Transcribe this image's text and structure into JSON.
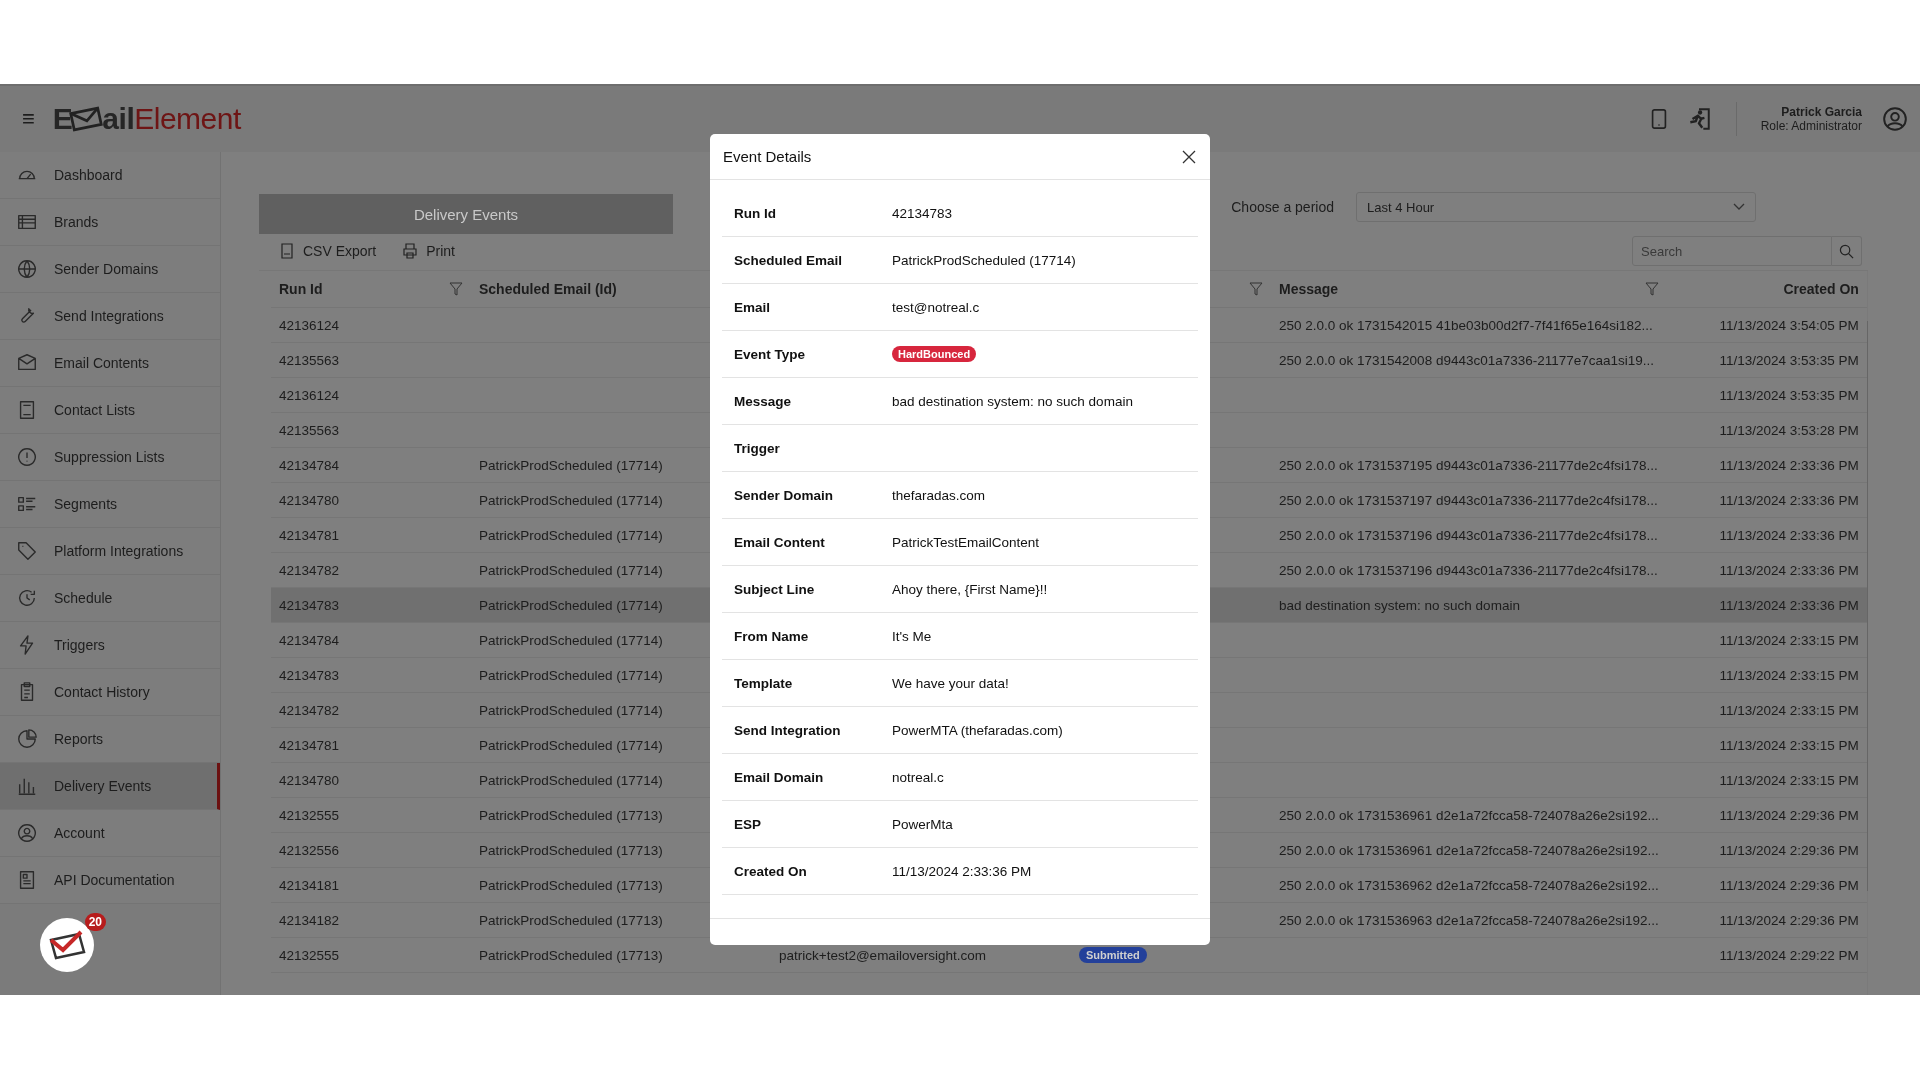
{
  "header": {
    "menu_glyph": "≡",
    "logo": {
      "lead": "E",
      "middle": "ail",
      "accent": "Element"
    },
    "user": {
      "name": "Patrick Garcia",
      "role": "Role: Administrator"
    }
  },
  "sidebar": {
    "items": [
      {
        "label": "Dashboard",
        "selected": false
      },
      {
        "label": "Brands",
        "selected": false
      },
      {
        "label": "Sender Domains",
        "selected": false
      },
      {
        "label": "Send Integrations",
        "selected": false
      },
      {
        "label": "Email Contents",
        "selected": false
      },
      {
        "label": "Contact Lists",
        "selected": false
      },
      {
        "label": "Suppression Lists",
        "selected": false
      },
      {
        "label": "Segments",
        "selected": false
      },
      {
        "label": "Platform Integrations",
        "selected": false
      },
      {
        "label": "Schedule",
        "selected": false
      },
      {
        "label": "Triggers",
        "selected": false
      },
      {
        "label": "Contact History",
        "selected": false
      },
      {
        "label": "Reports",
        "selected": false
      },
      {
        "label": "Delivery Events",
        "selected": true
      },
      {
        "label": "Account",
        "selected": false
      },
      {
        "label": "API Documentation",
        "selected": false
      }
    ]
  },
  "notification": {
    "count": "20"
  },
  "tab": {
    "label": "Delivery Events"
  },
  "toolbar": {
    "buttons": [
      "CSV Export",
      "Print"
    ]
  },
  "period": {
    "label": "Choose a period",
    "value": "Last 4 Hour"
  },
  "search": {
    "placeholder": "Search"
  },
  "table": {
    "columns": [
      {
        "label": "Run Id",
        "filterable": true
      },
      {
        "label": "Scheduled Email (Id)"
      },
      {},
      {
        "filterable": true
      },
      {
        "label": "Message",
        "filterable": true
      },
      {
        "label": "Created On",
        "filterable": false
      }
    ],
    "rows": [
      {
        "run_id": "42136124",
        "message": "250 2.0.0 ok 1731542015 41be03b00d2f7-7f41f65e164si182...",
        "created_on": "11/13/2024 3:54:05 PM",
        "selected": false
      },
      {
        "run_id": "42135563",
        "message": "250 2.0.0 ok 1731542008 d9443c01a7336-21177e7caa1si19...",
        "created_on": "11/13/2024 3:53:35 PM",
        "selected": false
      },
      {
        "run_id": "42136124",
        "created_on": "11/13/2024 3:53:35 PM",
        "selected": false
      },
      {
        "run_id": "42135563",
        "created_on": "11/13/2024 3:53:28 PM",
        "selected": false
      },
      {
        "run_id": "42134784",
        "scheduled_email": "PatrickProdScheduled (17714)",
        "message": "250 2.0.0 ok 1731537195 d9443c01a7336-21177de2c4fsi178...",
        "created_on": "11/13/2024 2:33:36 PM",
        "selected": false
      },
      {
        "run_id": "42134780",
        "scheduled_email": "PatrickProdScheduled (17714)",
        "message": "250 2.0.0 ok 1731537197 d9443c01a7336-21177de2c4fsi178...",
        "created_on": "11/13/2024 2:33:36 PM",
        "selected": false
      },
      {
        "run_id": "42134781",
        "scheduled_email": "PatrickProdScheduled (17714)",
        "message": "250 2.0.0 ok 1731537196 d9443c01a7336-21177de2c4fsi178...",
        "created_on": "11/13/2024 2:33:36 PM",
        "selected": false
      },
      {
        "run_id": "42134782",
        "scheduled_email": "PatrickProdScheduled (17714)",
        "message": "250 2.0.0 ok 1731537196 d9443c01a7336-21177de2c4fsi178...",
        "created_on": "11/13/2024 2:33:36 PM",
        "selected": false
      },
      {
        "run_id": "42134783",
        "scheduled_email": "PatrickProdScheduled (17714)",
        "message": "bad destination system: no such domain",
        "created_on": "11/13/2024 2:33:36 PM",
        "selected": true
      },
      {
        "run_id": "42134784",
        "scheduled_email": "PatrickProdScheduled (17714)",
        "created_on": "11/13/2024 2:33:15 PM",
        "selected": false
      },
      {
        "run_id": "42134783",
        "scheduled_email": "PatrickProdScheduled (17714)",
        "created_on": "11/13/2024 2:33:15 PM",
        "selected": false
      },
      {
        "run_id": "42134782",
        "scheduled_email": "PatrickProdScheduled (17714)",
        "created_on": "11/13/2024 2:33:15 PM",
        "selected": false
      },
      {
        "run_id": "42134781",
        "scheduled_email": "PatrickProdScheduled (17714)",
        "created_on": "11/13/2024 2:33:15 PM",
        "selected": false
      },
      {
        "run_id": "42134780",
        "scheduled_email": "PatrickProdScheduled (17714)",
        "created_on": "11/13/2024 2:33:15 PM",
        "selected": false
      },
      {
        "run_id": "42132555",
        "scheduled_email": "PatrickProdScheduled (17713)",
        "message": "250 2.0.0 ok 1731536961 d2e1a72fcca58-724078a26e2si192...",
        "created_on": "11/13/2024 2:29:36 PM",
        "selected": false
      },
      {
        "run_id": "42132556",
        "scheduled_email": "PatrickProdScheduled (17713)",
        "message": "250 2.0.0 ok 1731536961 d2e1a72fcca58-724078a26e2si192...",
        "created_on": "11/13/2024 2:29:36 PM",
        "selected": false
      },
      {
        "run_id": "42134181",
        "scheduled_email": "PatrickProdScheduled (17713)",
        "message": "250 2.0.0 ok 1731536962 d2e1a72fcca58-724078a26e2si192...",
        "created_on": "11/13/2024 2:29:36 PM",
        "selected": false
      },
      {
        "run_id": "42134182",
        "scheduled_email": "PatrickProdScheduled (17713)",
        "message": "250 2.0.0 ok 1731536963 d2e1a72fcca58-724078a26e2si192...",
        "created_on": "11/13/2024 2:29:36 PM",
        "selected": false
      },
      {
        "run_id": "42132555",
        "scheduled_email": "PatrickProdScheduled (17713)",
        "email": "patrick+test2@emailoversight.com",
        "event_type": {
          "label": "Submitted",
          "color": "#23409a"
        },
        "created_on": "11/13/2024 2:29:22 PM",
        "selected": false
      }
    ]
  },
  "modal": {
    "title": "Event Details",
    "fields": [
      {
        "label": "Run Id",
        "kind": "text",
        "value": "42134783"
      },
      {
        "label": "Scheduled Email",
        "kind": "text",
        "value": "PatrickProdScheduled (17714)"
      },
      {
        "label": "Email",
        "kind": "text",
        "value": "test@notreal.c"
      },
      {
        "label": "Event Type",
        "kind": "badge",
        "value": "HardBounced",
        "color": "#d7263d"
      },
      {
        "label": "Message",
        "kind": "text",
        "value": "bad destination system: no such domain"
      },
      {
        "label": "Trigger",
        "kind": "text"
      },
      {
        "label": "Sender Domain",
        "kind": "text",
        "value": "thefaradas.com"
      },
      {
        "label": "Email Content",
        "kind": "text",
        "value": "PatrickTestEmailContent"
      },
      {
        "label": "Subject Line",
        "kind": "text",
        "value": "Ahoy there, {First Name}!!"
      },
      {
        "label": "From Name",
        "kind": "text",
        "value": "It's Me"
      },
      {
        "label": "Template",
        "kind": "text",
        "value": "We have your data!"
      },
      {
        "label": "Send Integration",
        "kind": "text",
        "value": "PowerMTA (thefaradas.com)"
      },
      {
        "label": "Email Domain",
        "kind": "text",
        "value": "notreal.c"
      },
      {
        "label": "ESP",
        "kind": "text",
        "value": "PowerMta"
      },
      {
        "label": "Created On",
        "kind": "text",
        "value": "11/13/2024 2:33:36 PM"
      }
    ]
  }
}
